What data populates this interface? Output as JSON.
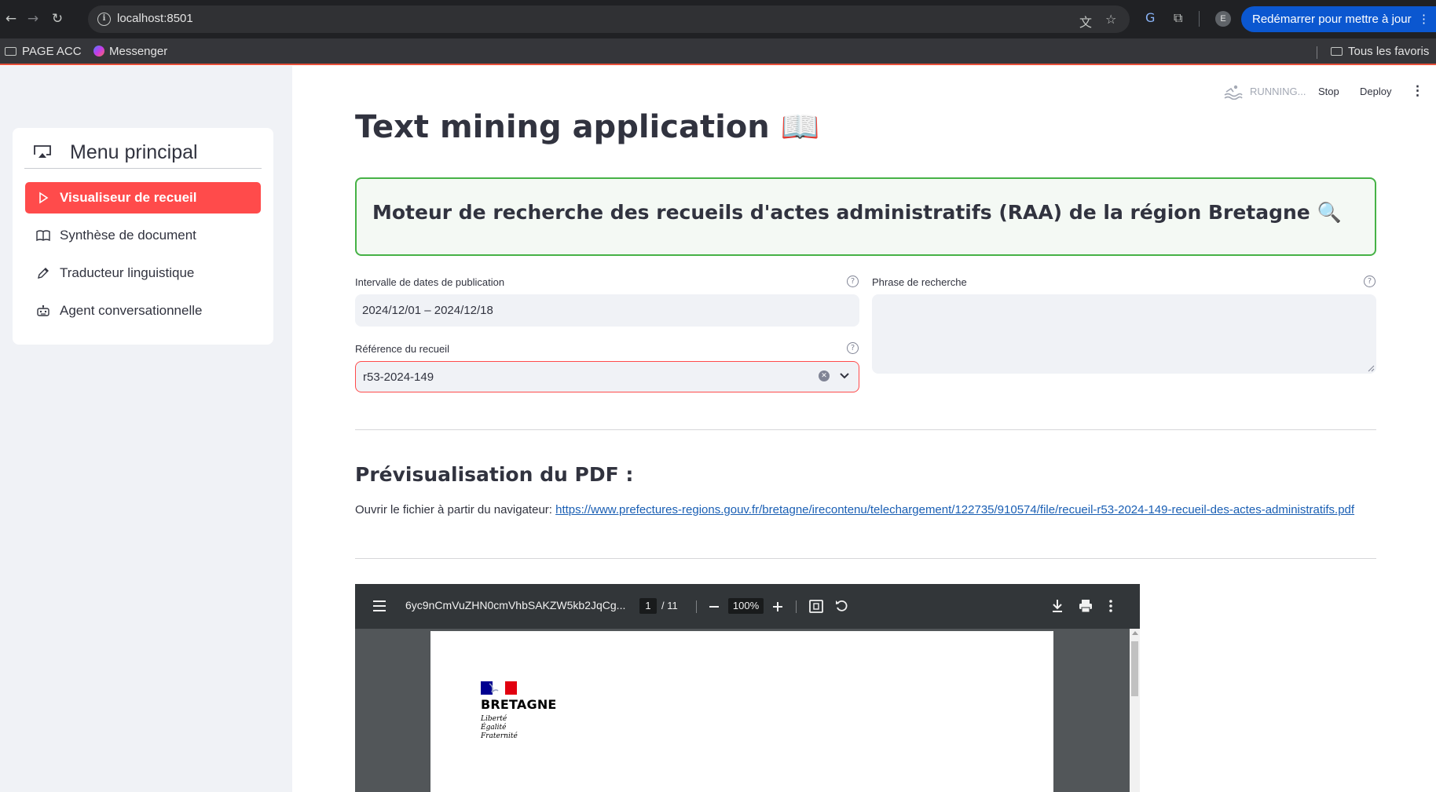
{
  "browser": {
    "url": "localhost:8501",
    "relaunch_label": "Redémarrer pour mettre à jour",
    "relaunch_menu": "⋮",
    "profile_initial": "E",
    "bookmarks": [
      {
        "label": "PAGE ACC"
      },
      {
        "label": "Messenger"
      }
    ],
    "all_bookmarks_label": "Tous les favoris"
  },
  "toolbar": {
    "running_label": "RUNNING...",
    "stop_label": "Stop",
    "deploy_label": "Deploy",
    "menu_label": "⋮"
  },
  "sidebar": {
    "title": "Menu principal",
    "items": [
      {
        "label": "Visualiseur de recueil",
        "icon": "play-icon",
        "active": true
      },
      {
        "label": "Synthèse de document",
        "icon": "book-icon",
        "active": false
      },
      {
        "label": "Traducteur linguistique",
        "icon": "pencil-icon",
        "active": false
      },
      {
        "label": "Agent conversationnelle",
        "icon": "robot-icon",
        "active": false
      }
    ]
  },
  "main": {
    "title": "Text mining application 📖",
    "banner": "Moteur de recherche des recueils d'actes administratifs (RAA) de la région Bretagne 🔍",
    "date_range": {
      "label": "Intervalle de dates de publication",
      "value": "2024/12/01 – 2024/12/18"
    },
    "search_phrase": {
      "label": "Phrase de recherche",
      "value": ""
    },
    "reference": {
      "label": "Référence du recueil",
      "value": "r53-2024-149"
    },
    "preview_title": "Prévisualisation du PDF :",
    "open_prefix": "Ouvrir le fichier à partir du navigateur:",
    "pdf_url": "https://www.prefectures-regions.gouv.fr/bretagne/irecontenu/telechargement/122735/910574/file/recueil-r53-2024-149-recueil-des-actes-administratifs.pdf"
  },
  "pdf_viewer": {
    "filename": "6yc9nCmVuZHN0cmVhbSAKZW5kb2JqCg...",
    "current_page": "1",
    "total_pages": "/ 11",
    "zoom": "100%",
    "document": {
      "region": "BRETAGNE",
      "motto": [
        "Liberté",
        "Égalité",
        "Fraternité"
      ]
    }
  },
  "colors": {
    "primary": "#ff4b4b",
    "banner_border": "#46b246",
    "link": "#1a5fb4",
    "relaunch": "#0b57d0"
  }
}
